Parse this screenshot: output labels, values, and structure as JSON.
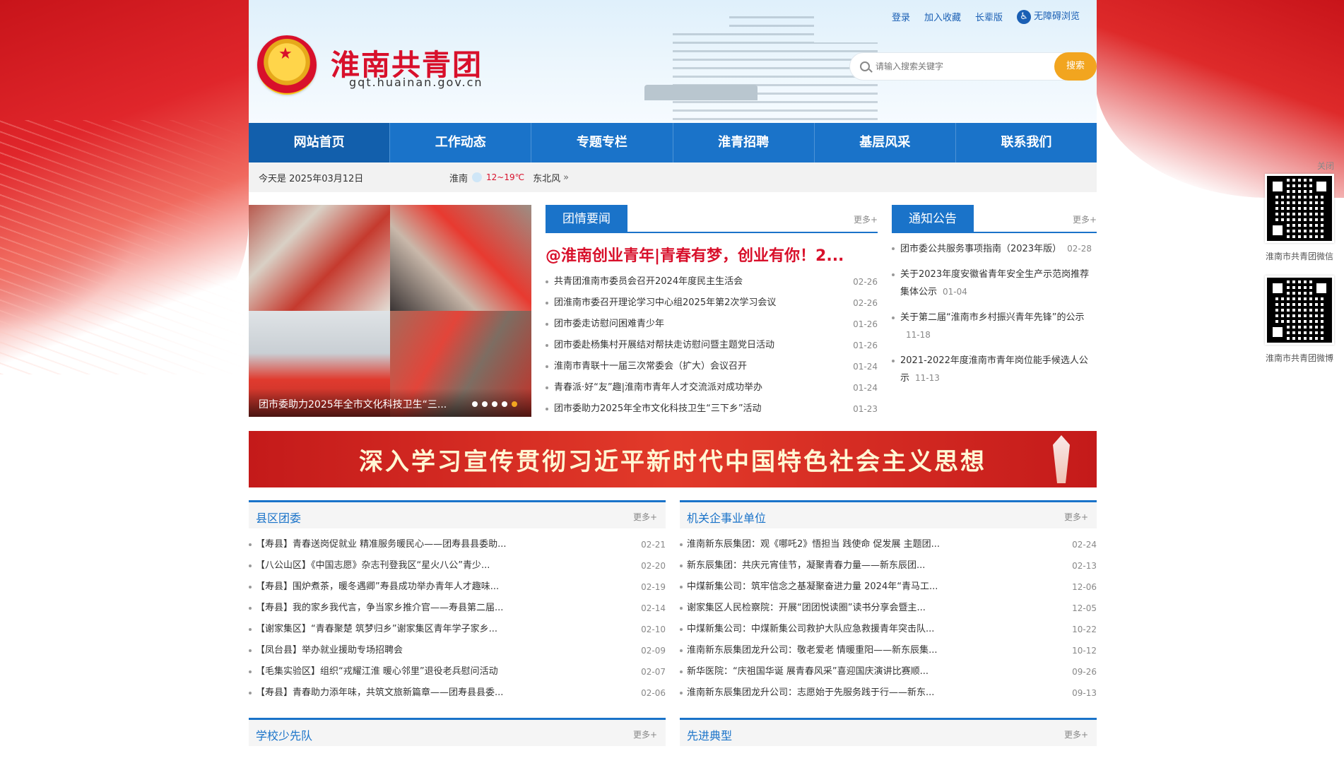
{
  "header": {
    "site_title": "淮南共青团",
    "site_domain": "gqt.huainan.gov.cn",
    "top_links": [
      "登录",
      "加入收藏",
      "长辈版",
      "无障碍浏览"
    ],
    "search_placeholder": "请输入搜索关键字",
    "search_button": "搜索"
  },
  "nav": [
    "网站首页",
    "工作动态",
    "专题专栏",
    "淮青招聘",
    "基层风采",
    "联系我们"
  ],
  "infobar": {
    "date": "今天是 2025年03月12日",
    "city": "淮南",
    "temp": "12~19℃",
    "wind": "东北风"
  },
  "slider": {
    "caption": "团市委助力2025年全市文化科技卫生“三...",
    "dots": 5,
    "active_dot": 5
  },
  "news": {
    "tab": "团情要闻",
    "more": "更多+",
    "headline": "@淮南创业青年|青春有梦，创业有你！2...",
    "items": [
      {
        "title": "共青团淮南市委员会召开2024年度民主生活会",
        "date": "02-26"
      },
      {
        "title": "团淮南市委召开理论学习中心组2025年第2次学习会议",
        "date": "02-26"
      },
      {
        "title": "团市委走访慰问困难青少年",
        "date": "01-26"
      },
      {
        "title": "团市委赴杨集村开展结对帮扶走访慰问暨主题党日活动",
        "date": "01-26"
      },
      {
        "title": "淮南市青联十一届三次常委会（扩大）会议召开",
        "date": "01-24"
      },
      {
        "title": "青春派·好“友”趣|淮南市青年人才交流派对成功举办",
        "date": "01-24"
      },
      {
        "title": "团市委助力2025年全市文化科技卫生“三下乡”活动",
        "date": "01-23"
      }
    ]
  },
  "notice": {
    "tab": "通知公告",
    "more": "更多+",
    "items": [
      {
        "title": "团市委公共服务事项指南（2023年版）",
        "date": "02-28"
      },
      {
        "title": "关于2023年度安徽省青年安全生产示范岗推荐集体公示",
        "date": "01-04"
      },
      {
        "title": "关于第二届“淮南市乡村振兴青年先锋”的公示",
        "date": "11-18"
      },
      {
        "title": "2021-2022年度淮南市青年岗位能手候选人公示",
        "date": "11-13"
      }
    ]
  },
  "banner": {
    "text": "深入学习宣传贯彻习近平新时代中国特色社会主义思想"
  },
  "panels": [
    {
      "title": "县区团委",
      "more": "更多+",
      "items": [
        {
          "title": "【寿县】青春送岗促就业 精准服务暖民心——团寿县县委助...",
          "date": "02-21"
        },
        {
          "title": "【八公山区】《中国志愿》杂志刊登我区“星火八公”青少...",
          "date": "02-20"
        },
        {
          "title": "【寿县】围炉煮茶，暖冬遇卿”寿县成功举办青年人才趣味...",
          "date": "02-19"
        },
        {
          "title": "【寿县】我的家乡我代言，争当家乡推介官——寿县第二届...",
          "date": "02-14"
        },
        {
          "title": "【谢家集区】“青春聚楚 筑梦归乡”谢家集区青年学子家乡...",
          "date": "02-10"
        },
        {
          "title": "【凤台县】举办就业援助专场招聘会",
          "date": "02-09"
        },
        {
          "title": "【毛集实验区】组织“戎耀江淮 暖心邻里”退役老兵慰问活动",
          "date": "02-07"
        },
        {
          "title": "【寿县】青春助力添年味，共筑文旅新篇章——团寿县县委...",
          "date": "02-06"
        }
      ]
    },
    {
      "title": "机关企事业单位",
      "more": "更多+",
      "items": [
        {
          "title": "淮南新东辰集团：观《哪吒2》悟担当 践使命 促发展 主题团...",
          "date": "02-24"
        },
        {
          "title": "新东辰集团：共庆元宵佳节，凝聚青春力量——新东辰团...",
          "date": "02-13"
        },
        {
          "title": "中煤新集公司：筑牢信念之基凝聚奋进力量 2024年“青马工...",
          "date": "12-06"
        },
        {
          "title": "谢家集区人民检察院：开展“团团悦读圈”读书分享会暨主...",
          "date": "12-05"
        },
        {
          "title": "中煤新集公司：中煤新集公司救护大队应急救援青年突击队...",
          "date": "10-22"
        },
        {
          "title": "淮南新东辰集团龙升公司：敬老爱老 情暖重阳——新东辰集...",
          "date": "10-12"
        },
        {
          "title": "新华医院：“庆祖国华诞 展青春风采”喜迎国庆演讲比赛顺...",
          "date": "09-26"
        },
        {
          "title": "淮南新东辰集团龙升公司：志愿始于先服务践于行——新东...",
          "date": "09-13"
        }
      ]
    },
    {
      "title": "学校少先队",
      "more": "更多+"
    },
    {
      "title": "先进典型",
      "more": "更多+"
    }
  ],
  "qr": [
    {
      "label": "淮南市共青团微信"
    },
    {
      "label": "淮南市共青团微博"
    }
  ],
  "qr_close": "关闭"
}
